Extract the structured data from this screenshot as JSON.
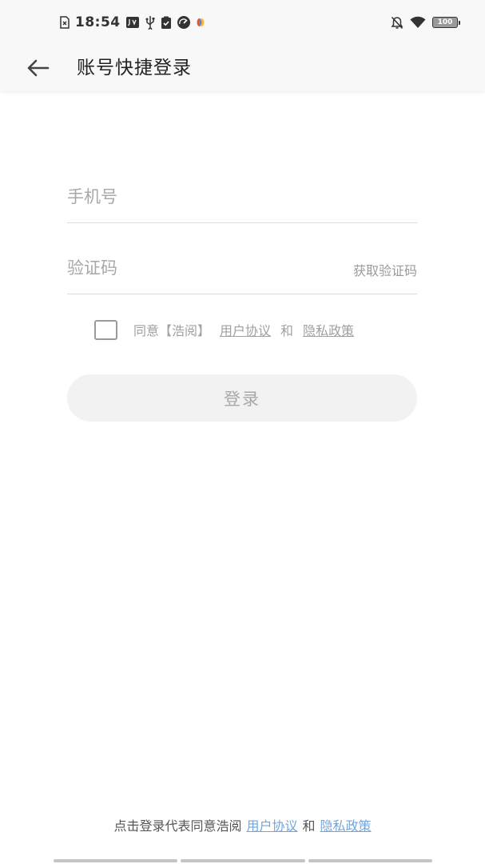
{
  "status_bar": {
    "time": "18:54",
    "battery": "100",
    "left_icons": [
      "sim-error-icon",
      "usb-debug-icon",
      "usb-icon",
      "clipboard-check-icon",
      "speed-icon",
      "app-notification-icon"
    ],
    "right_icons": [
      "bell-muted-icon",
      "wifi-icon",
      "battery-icon"
    ]
  },
  "app_bar": {
    "back_icon": "arrow-left-icon",
    "title": "账号快捷登录"
  },
  "form": {
    "phone_placeholder": "手机号",
    "phone_value": "",
    "code_placeholder": "验证码",
    "code_value": "",
    "get_code_label": "获取验证码",
    "agree_checked": false,
    "agree_prefix": "同意【浩阅】",
    "user_agreement": "用户协议",
    "and": "和",
    "privacy_policy": "隐私政策",
    "login_label": "登录"
  },
  "footer": {
    "text": "点击登录代表同意浩阅",
    "user_agreement": "用户协议",
    "and": "和",
    "privacy_policy": "隐私政策"
  },
  "colors": {
    "link_blue": "#6fa6de",
    "muted_gray": "#a0a0a0",
    "button_bg": "#f2f2f2",
    "header_bg": "#f8f8f8"
  }
}
